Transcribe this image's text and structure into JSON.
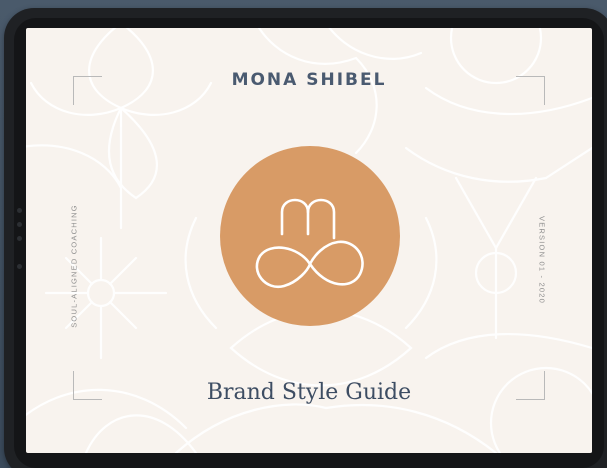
{
  "cover": {
    "brand_name": "MONA SHIBEL",
    "tagline": "SOUL-ALIGNED COACHING",
    "version": "VERSION 01 - 2020",
    "title": "Brand Style Guide"
  },
  "colors": {
    "backdrop": "#3f4f60",
    "tablet_frame": "#1f2124",
    "screen_background": "#f8f3ee",
    "accent_disc": "#d89b66",
    "heading_text": "#4a5a70",
    "pattern_lines": "#ffffff"
  },
  "icons": {
    "logo": "mb-infinity-monogram-icon",
    "background": "botanical-line-pattern"
  }
}
